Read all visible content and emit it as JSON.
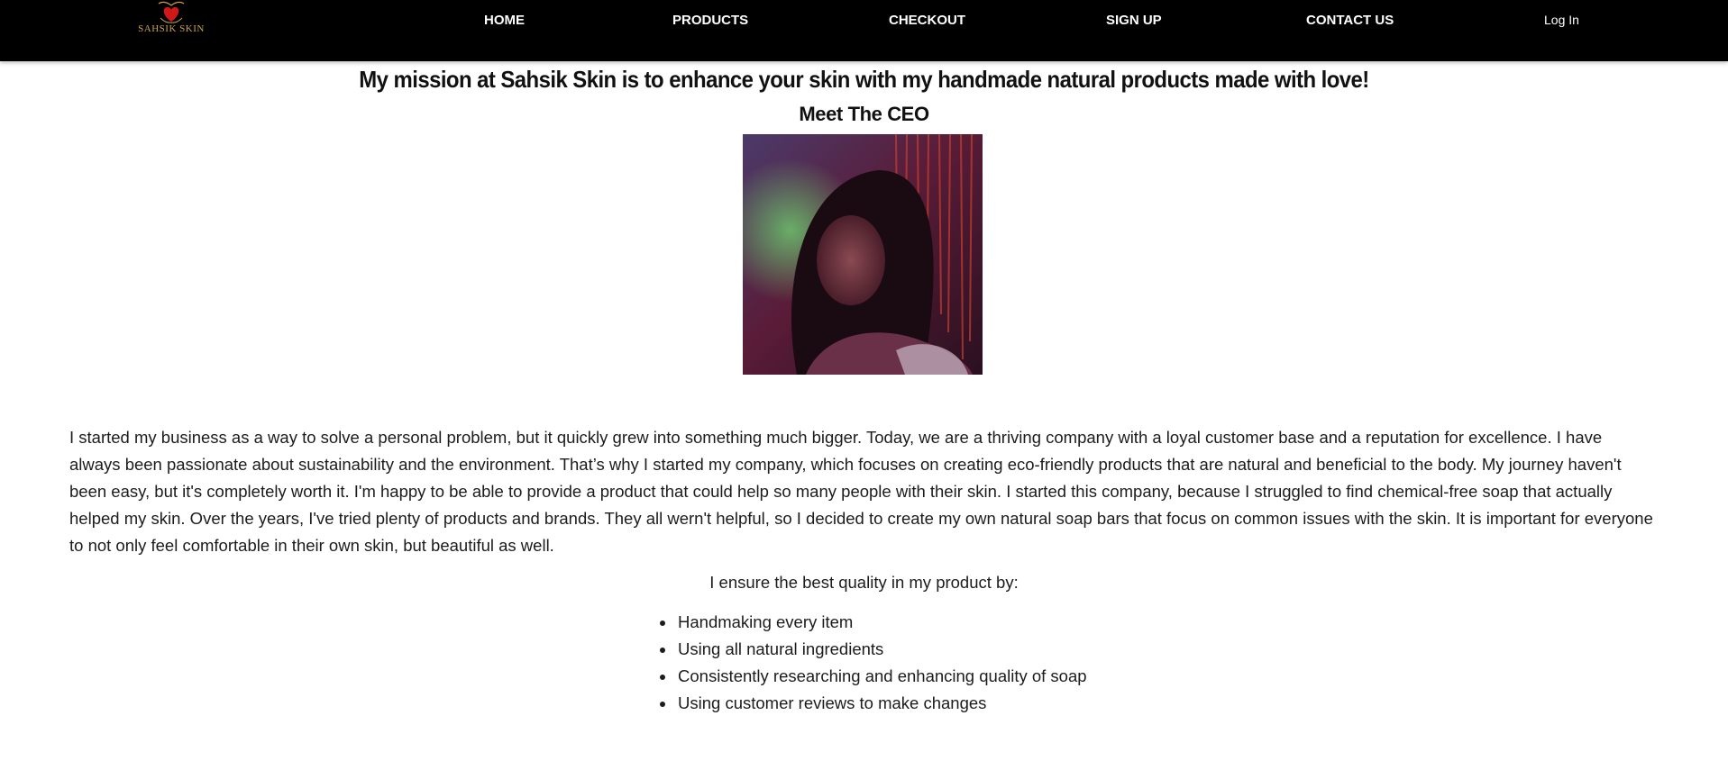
{
  "header": {
    "logo_text": "SAHSIK SKIN",
    "nav": [
      {
        "label": "HOME"
      },
      {
        "label": "PRODUCTS"
      },
      {
        "label": "CHECKOUT"
      },
      {
        "label": "SIGN UP"
      },
      {
        "label": "CONTACT US"
      }
    ],
    "login_label": "Log In",
    "colors": {
      "bar": "#000000",
      "logo_heart": "#d01818",
      "logo_gold": "#c8a04a"
    }
  },
  "main": {
    "mission_heading": "My mission at Sahsik Skin is to enhance your skin with my handmade natural products made with love!",
    "ceo_heading": "Meet The CEO",
    "about_paragraph": "I started my business as a way to solve a personal problem, but it quickly grew into something much bigger. Today, we are a thriving company with a loyal customer base and a reputation for excellence. I have always been passionate about sustainability and the environment. That’s why I started my company, which focuses on creating eco-friendly products that are natural and beneficial to the body. My journey haven't been easy, but it's completely worth it. I'm happy to be able to provide a product that could help so many people with their skin. I started this company, because I struggled to find chemical-free soap that actually helped my skin. Over the years, I've tried plenty of products and brands. They all wern't helpful, so I decided to create my own natural soap bars that focus on common issues with the skin. It is important for everyone to not only feel comfortable in their own skin, but beautiful as well.",
    "quality_intro": "I ensure the best quality in my product by:",
    "quality_items": [
      "Handmaking every item",
      "Using all natural ingredients",
      "Consistently researching and enhancing quality of soap",
      "Using customer reviews to make changes"
    ]
  }
}
